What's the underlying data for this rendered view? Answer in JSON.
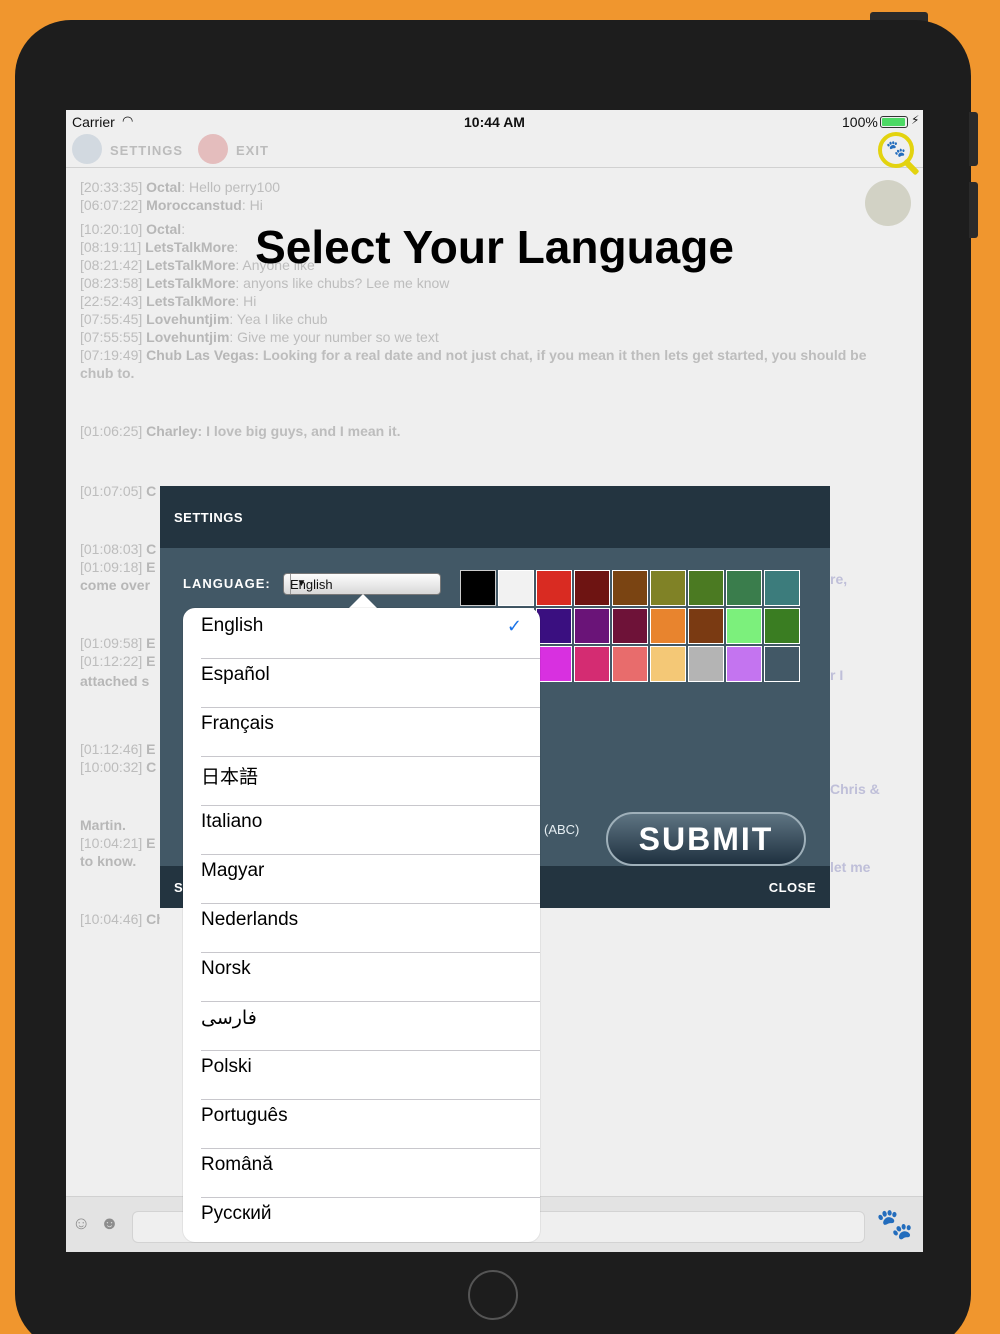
{
  "status_bar": {
    "carrier": "Carrier",
    "time": "10:44 AM",
    "battery": "100%"
  },
  "toolbar": {
    "settings_label": "SETTINGS",
    "exit_label": "EXIT"
  },
  "chat": [
    {
      "time": "[20:33:35]",
      "user": "Octal",
      "text": ": Hello perry100"
    },
    {
      "time": "[06:07:22]",
      "user": "Moroccanstud",
      "text": ": Hi"
    },
    {
      "time": "[10:20:10]",
      "user": "Octal",
      "text": ":"
    },
    {
      "time": "[08:19:11]",
      "user": "LetsTalkMore",
      "text": ":"
    },
    {
      "time": "[08:21:42]",
      "user": "LetsTalkMore",
      "text": ": Anyone like"
    },
    {
      "time": "[08:23:58]",
      "user": "LetsTalkMore",
      "text": ": anyons like chubs? Lee me know"
    },
    {
      "time": "[22:52:43]",
      "user": "LetsTalkMore",
      "text": ": Hi"
    },
    {
      "time": "[07:55:45]",
      "user": "Lovehuntjim",
      "text": ": Yea I like chub"
    },
    {
      "time": "[07:55:55]",
      "user": "Lovehuntjim",
      "text": ": Give me your number so we text"
    },
    {
      "time": "[07:19:49]",
      "user": "Chub Las Vegas",
      "text": ": Looking for a real date and not just chat, if you mean it then lets get started, you should be chub to."
    },
    {
      "time": "[01:06:25]",
      "user": "Charley",
      "text": ": I love big guys, and I mean it."
    },
    {
      "time": "[01:07:05]",
      "user": "C",
      "text": ""
    },
    {
      "time": "[01:08:03]",
      "user": "C",
      "text": ""
    },
    {
      "time": "[01:09:18]",
      "user": "E",
      "text": ""
    },
    {
      "time": "",
      "user": "come over",
      "text": ""
    },
    {
      "time": "[01:09:58]",
      "user": "E",
      "text": ""
    },
    {
      "time": "[01:12:22]",
      "user": "E",
      "text": ""
    },
    {
      "time": "",
      "user": "attached s",
      "text": ""
    },
    {
      "time": "[01:12:46]",
      "user": "E",
      "text": ""
    },
    {
      "time": "[10:00:32]",
      "user": "C",
      "text": ""
    },
    {
      "time": "",
      "user": "Martin.",
      "text": ""
    },
    {
      "time": "[10:04:21]",
      "user": "E",
      "text": ""
    },
    {
      "time": "",
      "user": "to know.",
      "text": ""
    },
    {
      "time": "[10:04:46]",
      "user": "Chu",
      "text": ""
    }
  ],
  "chat_fragments_right": [
    "re,",
    "r I",
    "Chris &",
    "let me"
  ],
  "heading": "Select Your Language",
  "settings": {
    "title": "SETTINGS",
    "language_label": "LANGUAGE:",
    "language_value": "English",
    "abc_label": "(ABC)",
    "submit_label": "SUBMIT",
    "footer_left": "S",
    "close_label": "CLOSE",
    "colors": [
      "#000000",
      "#f2f2f2",
      "#d92b22",
      "#6e1412",
      "#7a4412",
      "#808226",
      "#4b7a22",
      "#3a7d4c",
      "#3c7c7c",
      "#2e2a80",
      "#3a0f80",
      "#6a1478",
      "#6e1238",
      "#e8842e",
      "#7a3a12",
      "#7cf07c",
      "#3a7d22",
      "#3a3adc",
      "#6a14e0",
      "#d830e0",
      "#d42c72",
      "#e86c6c",
      "#f4c876",
      "#b4b4b4",
      "#c474f0"
    ]
  },
  "languages": {
    "selected": "English",
    "items": [
      "English",
      "Español",
      "Français",
      "日本語",
      "Italiano",
      "Magyar",
      "Nederlands",
      "Norsk",
      "فارسی",
      "Polski",
      "Português",
      "Română",
      "Русский"
    ]
  }
}
